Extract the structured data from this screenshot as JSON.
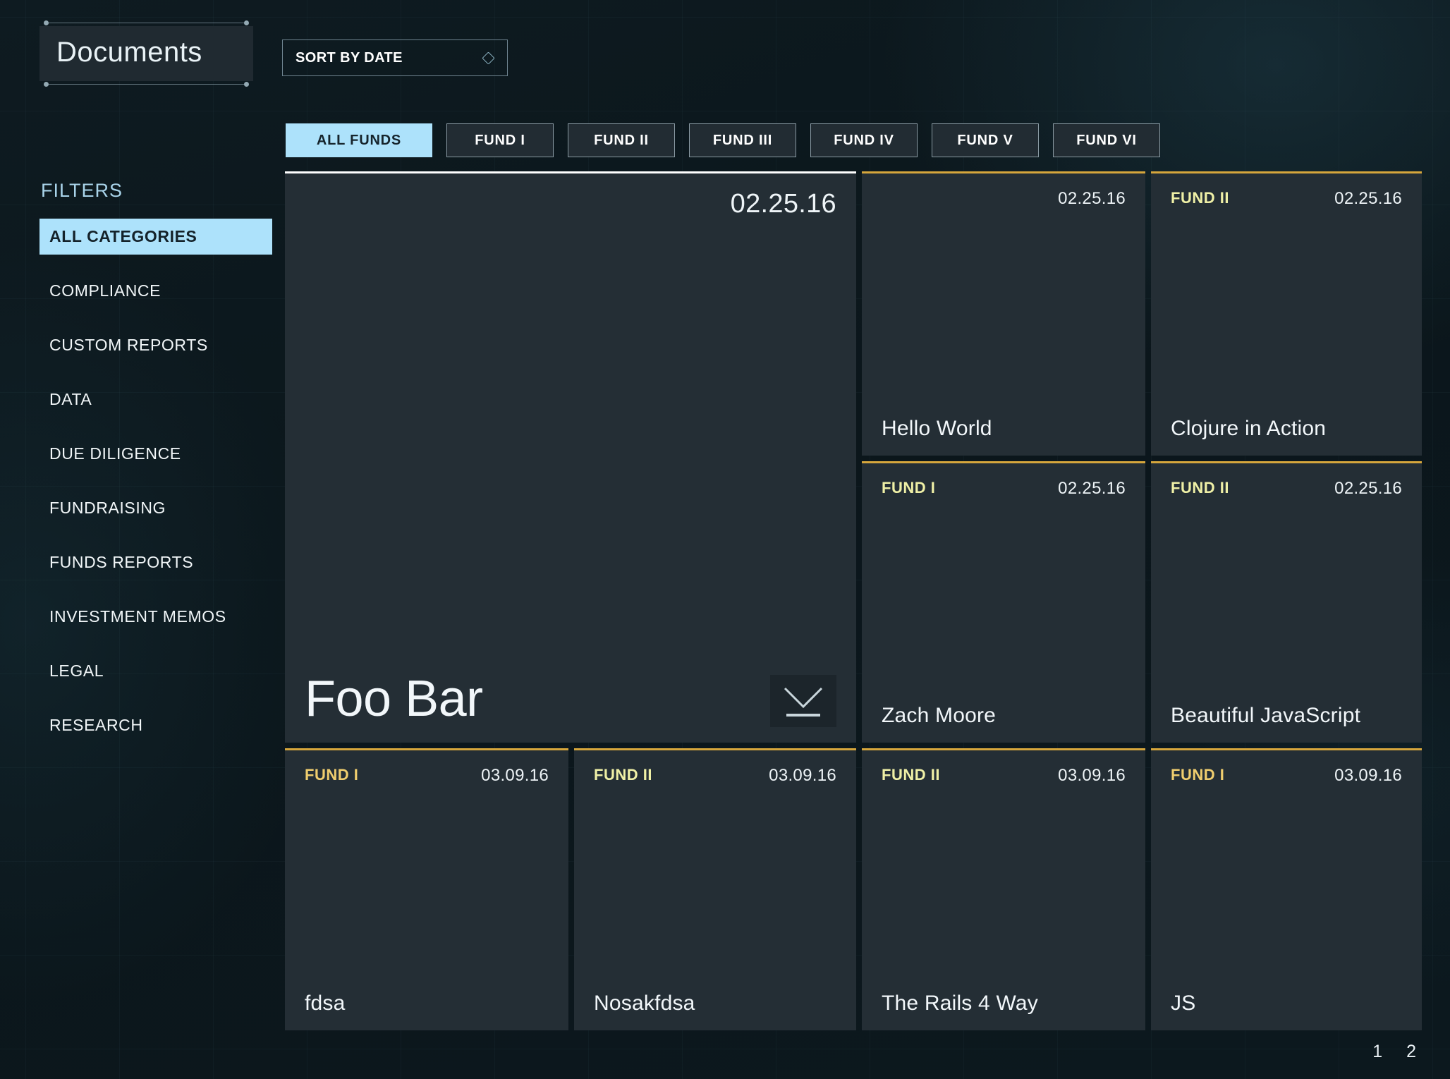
{
  "header": {
    "title": "Documents",
    "sort": {
      "label": "SORT BY DATE",
      "icon": "diamond-icon"
    }
  },
  "sidebar": {
    "heading": "FILTERS",
    "items": [
      {
        "label": "ALL CATEGORIES",
        "active": true
      },
      {
        "label": "COMPLIANCE",
        "active": false
      },
      {
        "label": "CUSTOM REPORTS",
        "active": false
      },
      {
        "label": "DATA",
        "active": false
      },
      {
        "label": "DUE DILIGENCE",
        "active": false
      },
      {
        "label": "FUNDRAISING",
        "active": false
      },
      {
        "label": "FUNDS REPORTS",
        "active": false
      },
      {
        "label": "INVESTMENT MEMOS",
        "active": false
      },
      {
        "label": "LEGAL",
        "active": false
      },
      {
        "label": "RESEARCH",
        "active": false
      }
    ]
  },
  "fund_tabs": [
    {
      "label": "ALL FUNDS",
      "active": true
    },
    {
      "label": "FUND I",
      "active": false
    },
    {
      "label": "FUND II",
      "active": false
    },
    {
      "label": "FUND III",
      "active": false
    },
    {
      "label": "FUND IV",
      "active": false
    },
    {
      "label": "FUND V",
      "active": false
    },
    {
      "label": "FUND VI",
      "active": false
    }
  ],
  "documents": [
    {
      "title": "Foo Bar",
      "date": "02.25.16",
      "fund": "",
      "hero": true,
      "download_icon": "download-icon"
    },
    {
      "title": "Hello World",
      "date": "02.25.16",
      "fund": "",
      "hero": false
    },
    {
      "title": "Clojure in Action",
      "date": "02.25.16",
      "fund": "FUND II",
      "hero": false
    },
    {
      "title": "Zach Moore",
      "date": "02.25.16",
      "fund": "FUND I",
      "hero": false
    },
    {
      "title": "Beautiful JavaScript",
      "date": "02.25.16",
      "fund": "FUND II",
      "hero": false
    },
    {
      "title": "fdsa",
      "date": "03.09.16",
      "fund": "FUND I",
      "hero": false
    },
    {
      "title": "Nosakfdsa",
      "date": "03.09.16",
      "fund": "FUND II",
      "hero": false
    },
    {
      "title": "The Rails 4 Way",
      "date": "03.09.16",
      "fund": "FUND II",
      "hero": false
    },
    {
      "title": "JS",
      "date": "03.09.16",
      "fund": "FUND I",
      "hero": false
    }
  ],
  "pagination": {
    "pages": [
      "1",
      "2"
    ]
  },
  "colors": {
    "accent_blue": "#ade2fb",
    "fund_yellow": "#eff0a6",
    "fund_gold": "#f0ce6e",
    "card_bg": "#242e35",
    "page_bg": "#0d1a20",
    "card_top_border": "#d6a63c"
  }
}
